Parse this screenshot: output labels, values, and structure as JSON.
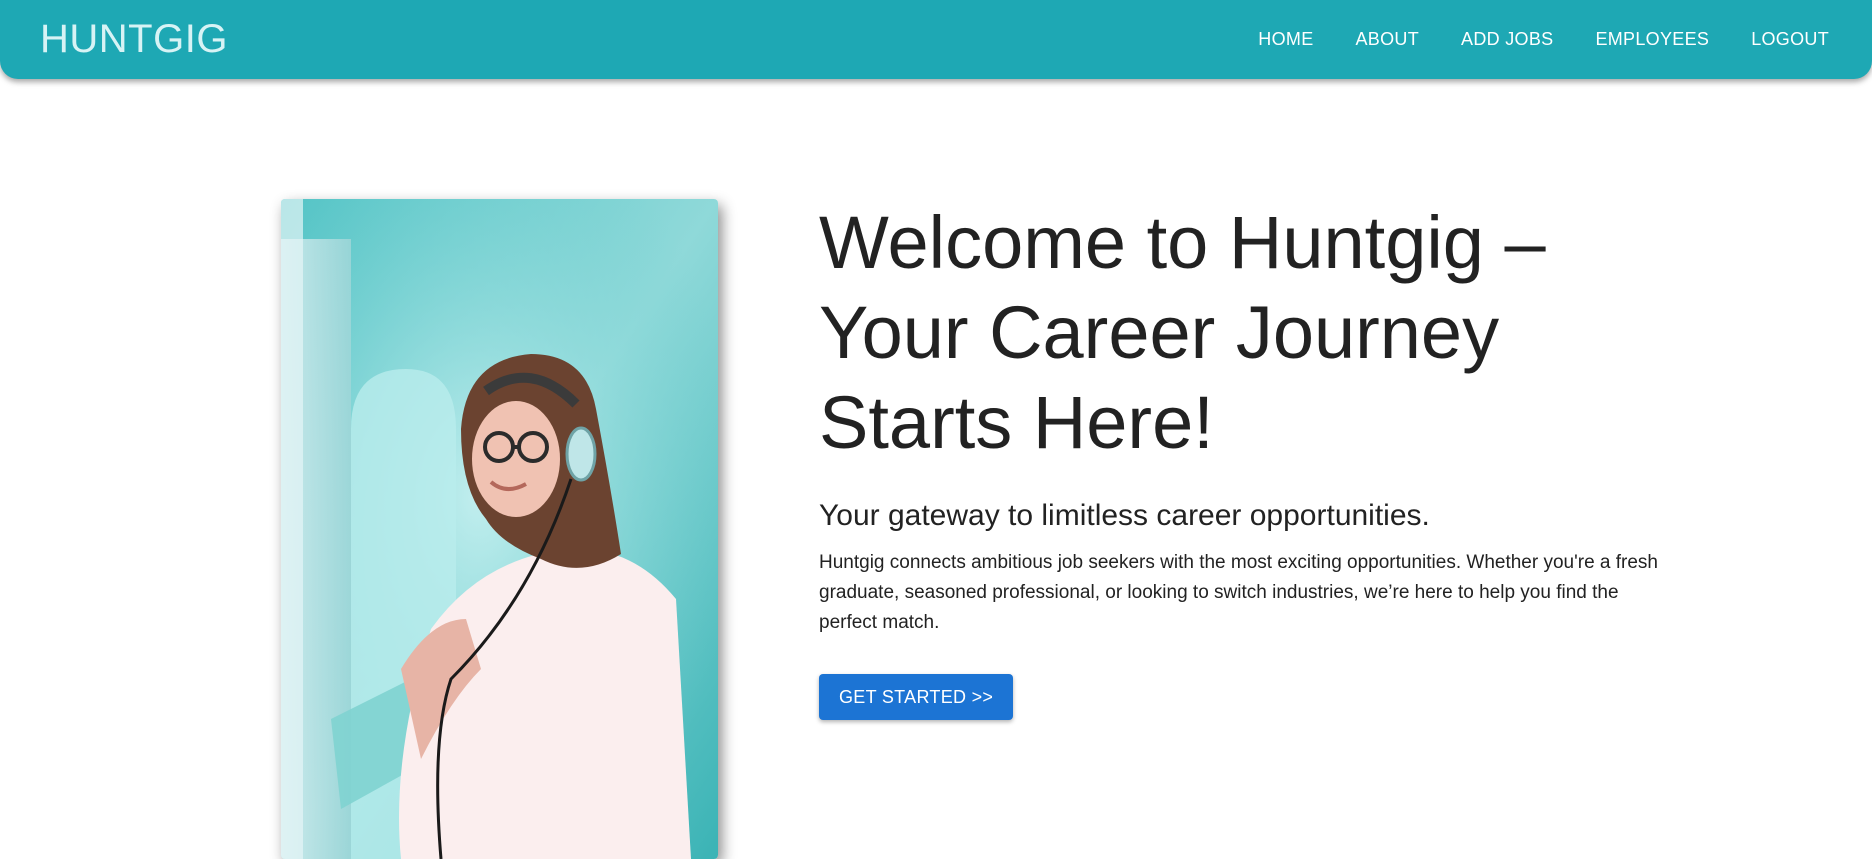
{
  "header": {
    "brand": "HUNTGIG",
    "nav": [
      {
        "label": "HOME"
      },
      {
        "label": "ABOUT"
      },
      {
        "label": "ADD JOBS"
      },
      {
        "label": "EMPLOYEES"
      },
      {
        "label": "LOGOUT"
      }
    ]
  },
  "hero": {
    "title": "Welcome to Huntgig – Your Career Journey Starts Here!",
    "subtitle": "Your gateway to limitless career opportunities.",
    "description": "Huntgig connects ambitious job seekers with the most exciting opportunities. Whether you're a fresh graduate, seasoned professional, or looking to switch industries, we’re here to help you find the perfect match.",
    "cta_label": "GET STARTED >>"
  },
  "colors": {
    "header_bg": "#1ea8b4",
    "brand_text": "#d7f3f5",
    "cta_bg": "#1c74d4"
  }
}
